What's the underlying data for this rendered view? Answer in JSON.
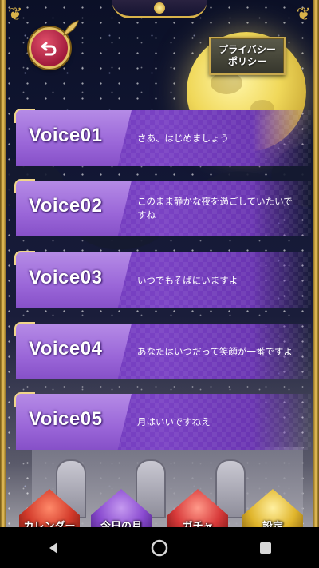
{
  "header": {
    "back_icon": "back-arrow-icon",
    "privacy_line1": "プライバシー",
    "privacy_line2": "ポリシー"
  },
  "voices": [
    {
      "title": "Voice01",
      "text": "さあ、はじめましょう"
    },
    {
      "title": "Voice02",
      "text": "このまま静かな夜を過ごしていたいですね"
    },
    {
      "title": "Voice03",
      "text": "いつでもそばにいますよ"
    },
    {
      "title": "Voice04",
      "text": "あなたはいつだって笑顔が一番ですよ"
    },
    {
      "title": "Voice05",
      "text": "月はいいですねえ"
    }
  ],
  "tabs": [
    {
      "label": "カレンダー",
      "color": "#d33a2a"
    },
    {
      "label": "今日の月",
      "color": "#8a4bd0"
    },
    {
      "label": "ガチャ",
      "color": "#d83a3a"
    },
    {
      "label": "設定",
      "color": "#e0b52c"
    }
  ],
  "navbar": {
    "back": "triangle-back-icon",
    "home": "circle-home-icon",
    "recent": "square-recent-icon"
  },
  "colors": {
    "accent_gold": "#d8b24a",
    "voice_purple": "#7a42c4",
    "back_button_red": "#a11b3c"
  }
}
